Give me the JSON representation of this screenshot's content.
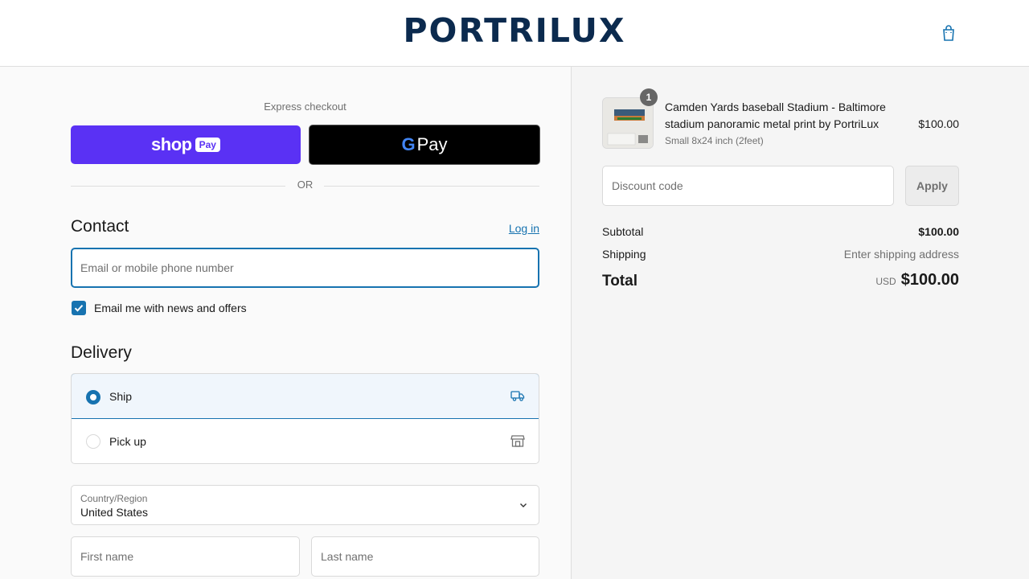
{
  "header": {
    "logo": "PORTRILUX",
    "cart_icon": "shopping-bag-icon"
  },
  "express": {
    "label": "Express checkout",
    "shop_pay": {
      "word": "shop",
      "pill": "Pay",
      "color": "#5a31f4"
    },
    "google_pay": {
      "g": "G",
      "word": "Pay"
    },
    "or_text": "OR"
  },
  "contact": {
    "title": "Contact",
    "login_link": "Log in",
    "email_placeholder": "Email or mobile phone number",
    "newsletter_label": "Email me with news and offers",
    "newsletter_checked": true
  },
  "delivery": {
    "title": "Delivery",
    "options": [
      {
        "label": "Ship",
        "selected": true,
        "icon": "truck-icon"
      },
      {
        "label": "Pick up",
        "selected": false,
        "icon": "store-icon"
      }
    ],
    "country_label": "Country/Region",
    "country_value": "United States",
    "first_name_placeholder": "First name",
    "last_name_placeholder": "Last name"
  },
  "summary": {
    "quantity": "1",
    "product_title": "Camden Yards baseball Stadium - Baltimore stadium panoramic metal print by PortriLux",
    "variant": "Small 8x24 inch (2feet)",
    "price": "$100.00",
    "discount_placeholder": "Discount code",
    "apply_label": "Apply",
    "subtotal_label": "Subtotal",
    "subtotal_value": "$100.00",
    "shipping_label": "Shipping",
    "shipping_value": "Enter shipping address",
    "total_label": "Total",
    "currency": "USD",
    "total_value": "$100.00"
  },
  "colors": {
    "accent": "#1773b0",
    "brand": "#0b2a4e"
  }
}
